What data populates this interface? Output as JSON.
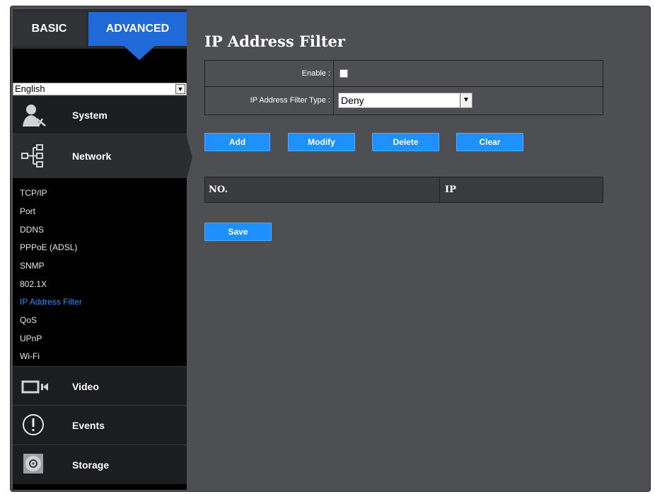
{
  "tabs": {
    "basic": "BASIC",
    "advanced": "ADVANCED"
  },
  "language": {
    "value": "English"
  },
  "sidebar": {
    "sections": [
      {
        "label": "System",
        "icon": "system-tools-icon"
      },
      {
        "label": "Network",
        "icon": "network-icon"
      },
      {
        "label": "Video",
        "icon": "video-camera-icon"
      },
      {
        "label": "Events",
        "icon": "alert-icon"
      },
      {
        "label": "Storage",
        "icon": "storage-disk-icon"
      }
    ],
    "network_items": [
      "TCP/IP",
      "Port",
      "DDNS",
      "PPPoE (ADSL)",
      "SNMP",
      "802.1X",
      "IP Address Filter",
      "QoS",
      "UPnP",
      "Wi-Fi"
    ],
    "active_item": "IP Address Filter"
  },
  "main": {
    "title": "IP Address Filter",
    "enable_label": "Enable :",
    "filter_type_label": "IP Address Filter Type :",
    "filter_type_value": "Deny",
    "buttons": {
      "add": "Add",
      "modify": "Modify",
      "delete": "Delete",
      "clear": "Clear",
      "save": "Save"
    },
    "table": {
      "columns": [
        "NO.",
        "IP"
      ],
      "rows": []
    }
  },
  "colors": {
    "accent": "#1e90ff",
    "tab_active": "#1f6ad6",
    "active_link": "#2f8bff",
    "panel": "#4d4f53"
  }
}
